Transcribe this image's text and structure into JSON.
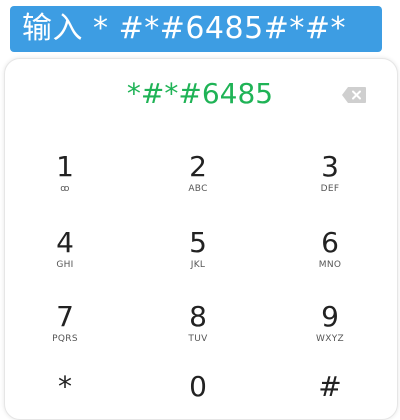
{
  "banner": {
    "text": "输入 * #*#6485#*#*",
    "color": "#3d9de3"
  },
  "dialer": {
    "entered_number": "*#*#6485",
    "number_color": "#1fb356",
    "backspace_icon": "backspace-icon",
    "keys": [
      {
        "digit": "1",
        "letters": "ꝏ"
      },
      {
        "digit": "2",
        "letters": "ABC"
      },
      {
        "digit": "3",
        "letters": "DEF"
      },
      {
        "digit": "4",
        "letters": "GHI"
      },
      {
        "digit": "5",
        "letters": "JKL"
      },
      {
        "digit": "6",
        "letters": "MNO"
      },
      {
        "digit": "7",
        "letters": "PQRS"
      },
      {
        "digit": "8",
        "letters": "TUV"
      },
      {
        "digit": "9",
        "letters": "WXYZ"
      },
      {
        "digit": "*",
        "letters": ""
      },
      {
        "digit": "0",
        "letters": ""
      },
      {
        "digit": "#",
        "letters": ""
      }
    ]
  }
}
